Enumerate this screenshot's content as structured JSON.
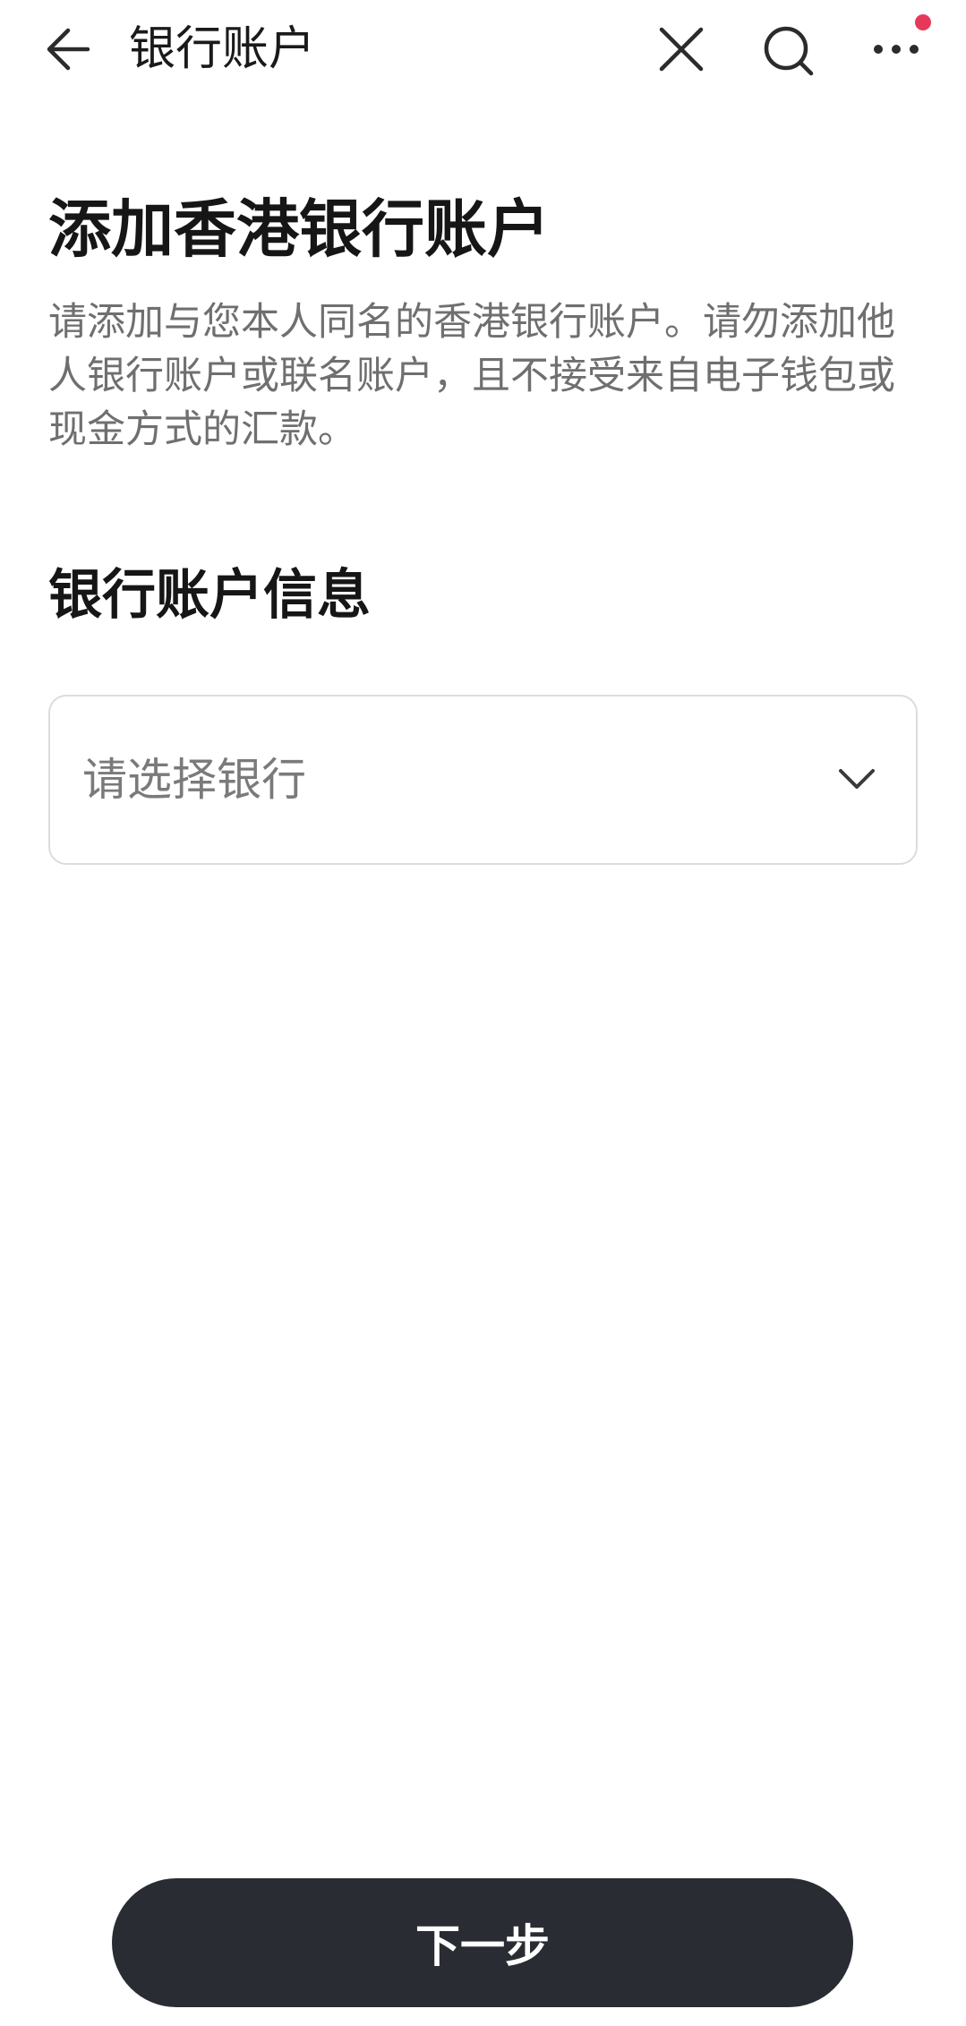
{
  "nav": {
    "title": "银行账户",
    "back_icon": "arrow-left-icon",
    "close_icon": "close-icon",
    "search_icon": "search-icon",
    "more_icon": "more-dots-icon",
    "notification_dot_color": "#e8385a"
  },
  "main": {
    "headline": "添加香港银行账户",
    "description": "请添加与您本人同名的香港银行账户。请勿添加他人银行账户或联名账户，且不接受来自电子钱包或现金方式的汇款。",
    "section_title": "银行账户信息",
    "bank_select": {
      "placeholder": "请选择银行",
      "icon": "chevron-down-icon"
    }
  },
  "footer": {
    "next_label": "下一步",
    "button_color": "#2a2c33"
  }
}
